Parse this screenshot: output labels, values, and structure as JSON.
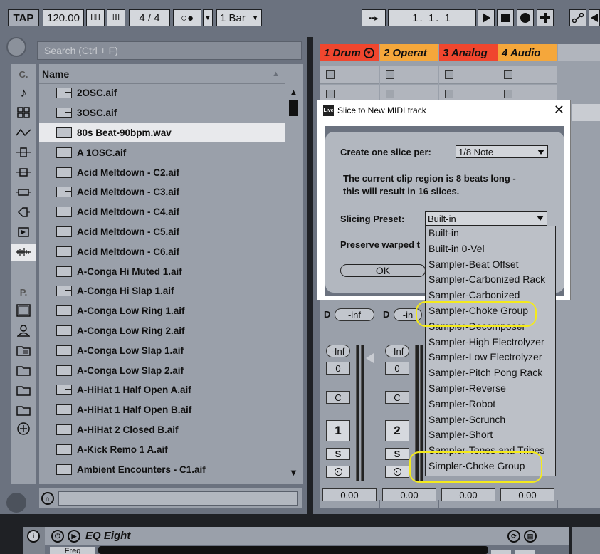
{
  "transport": {
    "tap_label": "TAP",
    "tempo": "120.00",
    "signature_num": "4",
    "signature_sep": "/",
    "signature_den": "4",
    "metronome": "○●",
    "quantize": "1 Bar",
    "position": "1.  1.  1"
  },
  "browser": {
    "search_placeholder": "Search (Ctrl + F)",
    "collections_label": "C.",
    "places_label": "P.",
    "name_header": "Name",
    "files": [
      "2OSC.aif",
      "3OSC.aif",
      "80s Beat-90bpm.wav",
      "A 1OSC.aif",
      "Acid Meltdown - C2.aif",
      "Acid Meltdown - C3.aif",
      "Acid Meltdown - C4.aif",
      "Acid Meltdown - C5.aif",
      "Acid Meltdown - C6.aif",
      "A-Conga Hi Muted 1.aif",
      "A-Conga Hi Slap 1.aif",
      "A-Conga Low Ring 1.aif",
      "A-Conga Low Ring 2.aif",
      "A-Conga Low Slap 1.aif",
      "A-Conga Low Slap 2.aif",
      "A-HiHat 1 Half Open A.aif",
      "A-HiHat 1 Half Open B.aif",
      "A-HiHat 2 Closed B.aif",
      "A-Kick Remo 1 A.aif",
      "Ambient Encounters - C1.aif"
    ],
    "selected_file": "80s Beat-90bpm.wav"
  },
  "tracks": [
    {
      "name": "1 Drum",
      "color": "#f0462e"
    },
    {
      "name": "2 Operat",
      "color": "#f5a73b"
    },
    {
      "name": "3 Analog",
      "color": "#f0462e"
    },
    {
      "name": "4 Audio",
      "color": "#f5a73b"
    }
  ],
  "mixer": {
    "d_label": "D",
    "send_value": "-inf",
    "send_value_partial": "-in",
    "volume": "-Inf",
    "pan": "0",
    "cue": "C",
    "track_numbers": [
      "1",
      "2"
    ],
    "solo": "S",
    "bottom_values": [
      "0.00",
      "0.00",
      "0.00",
      "0.00"
    ]
  },
  "dialog": {
    "title": "Slice to New MIDI track",
    "icon_text": "Live",
    "slice_label": "Create one slice per:",
    "slice_value": "1/8 Note",
    "info_line1": "The current clip region is 8 beats long -",
    "info_line2": "this will result in 16 slices.",
    "preset_label": "Slicing Preset:",
    "preset_value": "Built-in",
    "preserve_label": "Preserve warped t",
    "ok_label": "OK"
  },
  "preset_options": [
    "Built-in",
    "Built-in 0-Vel",
    "Sampler-Beat Offset",
    "Sampler-Carbonized Rack",
    "Sampler-Carbonized",
    "Sampler-Choke Group",
    "Sampler-Decomposer",
    "Sampler-High Electrolyzer",
    "Sampler-Low Electrolyzer",
    "Sampler-Pitch Pong Rack",
    "Sampler-Reverse",
    "Sampler-Robot",
    "Sampler-Scrunch",
    "Sampler-Short",
    "Sampler-Tones and Tribes",
    "Simpler-Choke Group"
  ],
  "highlighted_options": [
    "Sampler-Choke Group",
    "Simpler-Choke Group"
  ],
  "highlight_color": "#f4ea1c",
  "device": {
    "title": "EQ Eight",
    "freq_label": "Freq"
  }
}
